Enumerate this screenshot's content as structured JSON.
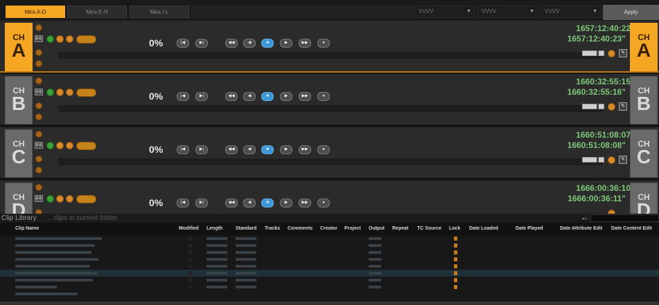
{
  "tabs": [
    {
      "label": "Mira A-D",
      "active": true
    },
    {
      "label": "Mira E-H",
      "active": false
    },
    {
      "label": "Mira I-L",
      "active": false
    }
  ],
  "selects": [
    {
      "value": "VVVV"
    },
    {
      "value": "VVVV"
    },
    {
      "value": "VVVV"
    }
  ],
  "apply_label": "Apply",
  "channels": [
    {
      "ch": "CH",
      "letter": "A",
      "active": true,
      "progress": "0%",
      "timecode": "1657:12:40:22",
      "timecode_alt": "1657:12:40:23\""
    },
    {
      "ch": "CH",
      "letter": "B",
      "active": false,
      "progress": "0%",
      "timecode": "1660:32:55:15",
      "timecode_alt": "1660:32:55:16\""
    },
    {
      "ch": "CH",
      "letter": "C",
      "active": false,
      "progress": "0%",
      "timecode": "1660:51:08:07",
      "timecode_alt": "1660:51:08:08\""
    },
    {
      "ch": "CH",
      "letter": "D",
      "active": false,
      "progress": "0%",
      "timecode": "1666:00:36:10",
      "timecode_alt": "1666:00:36:11\""
    }
  ],
  "icons": {
    "ee_label": "E-E",
    "transport": [
      "skip-back-icon",
      "skip-forward-icon",
      "rewind-icon",
      "step-back-icon",
      "stop-icon",
      "play-icon",
      "fast-forward-icon",
      "record-icon"
    ],
    "transport_glyphs": [
      "|◀",
      "▶|",
      "◀◀",
      "◀",
      "■",
      "▶",
      "▶▶",
      "●"
    ]
  },
  "library": {
    "title": "Clip Library",
    "hint": "... clips in current folder",
    "back_glyph": "←",
    "columns": [
      "Clip Name",
      "Modified",
      "Length",
      "Standard",
      "Tracks",
      "Comments",
      "Creator",
      "Project",
      "Output",
      "Repeat",
      "TC Source",
      "Lock",
      "Date Loaded",
      "Date Played",
      "Date Attribute Edit",
      "Date Content Edit"
    ]
  },
  "colors": {
    "accent": "#f5a623",
    "timecode": "#7fc87a",
    "stop_button": "#3c97d6",
    "record_green": "#3aa03a"
  }
}
